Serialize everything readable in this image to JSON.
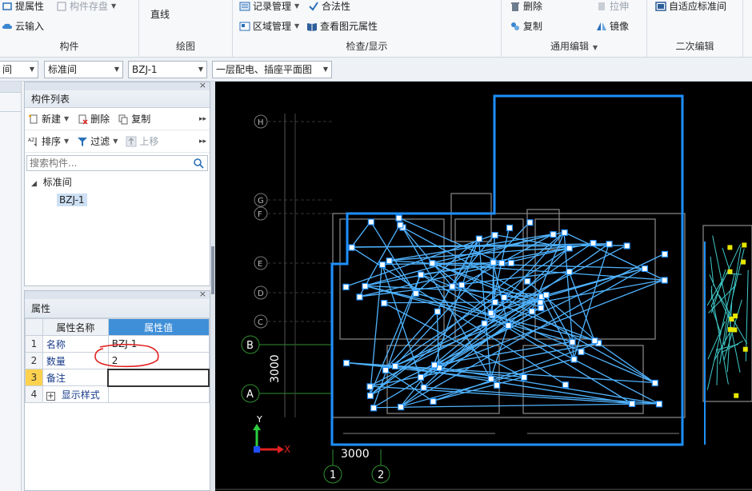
{
  "ribbon": {
    "group_component": {
      "title": "构件",
      "buttons": [
        {
          "label": "提属性",
          "icon": "extract-attribute-icon",
          "enabled": true
        },
        {
          "label": "构件存盘",
          "icon": "component-save-icon",
          "enabled": false
        },
        {
          "label": "云输入",
          "icon": "cloud-input-icon",
          "enabled": true
        }
      ]
    },
    "group_draw": {
      "title": "绘图",
      "buttons": [
        {
          "label": "直线",
          "icon": "line-icon"
        }
      ]
    },
    "group_check": {
      "title": "检查/显示",
      "buttons": [
        {
          "label": "记录管理",
          "icon": "record-manage-icon"
        },
        {
          "label": "合法性",
          "icon": "check-mark-icon"
        },
        {
          "label": "区域管理",
          "icon": "area-manage-icon"
        },
        {
          "label": "查看图元属性",
          "icon": "view-element-attr-icon"
        }
      ]
    },
    "group_edit": {
      "title": "通用编辑",
      "buttons": [
        {
          "label": "删除",
          "icon": "delete-icon",
          "enabled": true
        },
        {
          "label": "拉伸",
          "icon": "stretch-icon",
          "enabled": false
        },
        {
          "label": "复制",
          "icon": "copy-icon",
          "enabled": true
        },
        {
          "label": "镜像",
          "icon": "mirror-icon",
          "enabled": true
        }
      ]
    },
    "group_secondary": {
      "title": "二次编辑",
      "buttons": [
        {
          "label": "自适应标准间",
          "icon": "adaptive-room-icon"
        }
      ]
    }
  },
  "selectbar": {
    "selects": [
      {
        "value": "间"
      },
      {
        "value": "标准间"
      },
      {
        "value": "BZJ-1"
      },
      {
        "value": "一层配电、插座平面图"
      }
    ]
  },
  "component_list": {
    "title": "构件列表",
    "toolbar1": [
      {
        "label": "新建",
        "icon": "new-icon"
      },
      {
        "label": "删除",
        "icon": "delete-icon"
      },
      {
        "label": "复制",
        "icon": "copy-icon"
      }
    ],
    "toolbar2": [
      {
        "label": "排序",
        "icon": "sort-icon"
      },
      {
        "label": "过滤",
        "icon": "filter-icon"
      },
      {
        "label": "上移",
        "icon": "move-up-icon"
      }
    ],
    "search_placeholder": "搜索构件...",
    "tree": {
      "root": "标准间",
      "child": "BZJ-1"
    }
  },
  "properties": {
    "title": "属性",
    "header_name": "属性名称",
    "header_value": "属性值",
    "rows": [
      {
        "num": "1",
        "name": "名称",
        "value": "BZJ-1"
      },
      {
        "num": "2",
        "name": "数量",
        "value": "2"
      },
      {
        "num": "3",
        "name": "备注",
        "value": ""
      },
      {
        "num": "4",
        "name": "显示样式",
        "value": ""
      }
    ],
    "expand_symbol": "+"
  },
  "canvas": {
    "axis_labels": [
      "H",
      "G",
      "F",
      "E",
      "D",
      "C",
      "B",
      "A"
    ],
    "grid_bottom": [
      "1",
      "2"
    ],
    "dim_vertical": "3000",
    "dim_horizontal": "3000",
    "ucs_x": "X",
    "ucs_y": "Y",
    "colors": {
      "selection": "#1e90ff",
      "wire": "#4fb3ff",
      "wall": "#9a9a9a",
      "grid": "#2f8f2f"
    }
  }
}
